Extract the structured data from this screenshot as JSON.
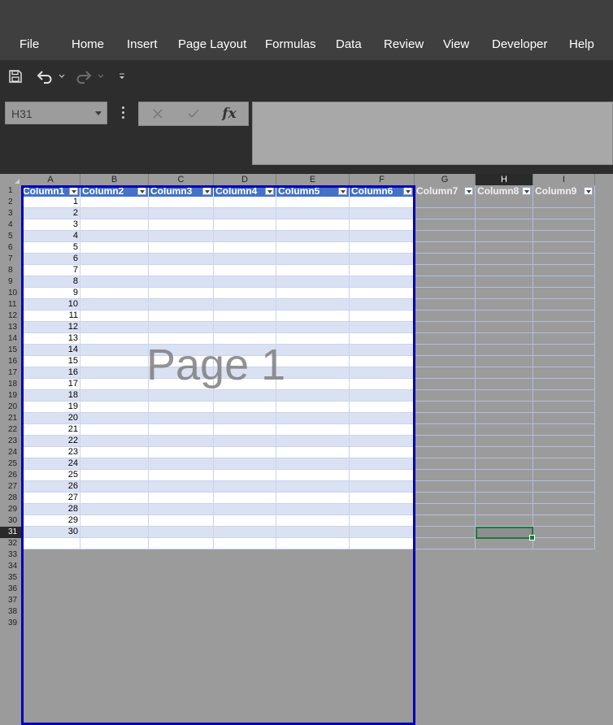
{
  "menu": [
    "File",
    "Home",
    "Insert",
    "Page Layout",
    "Formulas",
    "Data",
    "Review",
    "View",
    "Developer",
    "Help"
  ],
  "quick_access": {
    "save_icon": "save-icon",
    "undo_icon": "undo-icon",
    "redo_icon": "redo-icon",
    "customize_icon": "customize-icon"
  },
  "formula_bar": {
    "name_box": "H31",
    "cancel_icon": "cancel-icon",
    "enter_icon": "enter-icon",
    "function_label": "fx",
    "content": ""
  },
  "columns": [
    "A",
    "B",
    "C",
    "D",
    "E",
    "F",
    "G",
    "H",
    "I"
  ],
  "selected_column": "H",
  "table_headers": [
    "Column1",
    "Column2",
    "Column3",
    "Column4",
    "Column5",
    "Column6",
    "Column7",
    "Column8",
    "Column9"
  ],
  "rows": [
    "1",
    "2",
    "3",
    "4",
    "5",
    "6",
    "7",
    "8",
    "9",
    "10",
    "11",
    "12",
    "13",
    "14",
    "15",
    "16",
    "17",
    "18",
    "19",
    "20",
    "21",
    "22",
    "23",
    "24",
    "25",
    "26",
    "27",
    "28",
    "29",
    "30",
    "31",
    "32",
    "33",
    "34",
    "35",
    "36",
    "37",
    "38",
    "39"
  ],
  "selected_row": "31",
  "column1_values": [
    "1",
    "2",
    "3",
    "4",
    "5",
    "6",
    "7",
    "8",
    "9",
    "10",
    "11",
    "12",
    "13",
    "14",
    "15",
    "16",
    "17",
    "18",
    "19",
    "20",
    "21",
    "22",
    "23",
    "24",
    "25",
    "26",
    "27",
    "28",
    "29",
    "30"
  ],
  "watermark": "Page 1",
  "active_cell": "H31",
  "colors": {
    "header_fill": "#4472c4",
    "band_light": "#dae1f3",
    "print_border": "#0000b4",
    "selection": "#1d7a3f"
  }
}
